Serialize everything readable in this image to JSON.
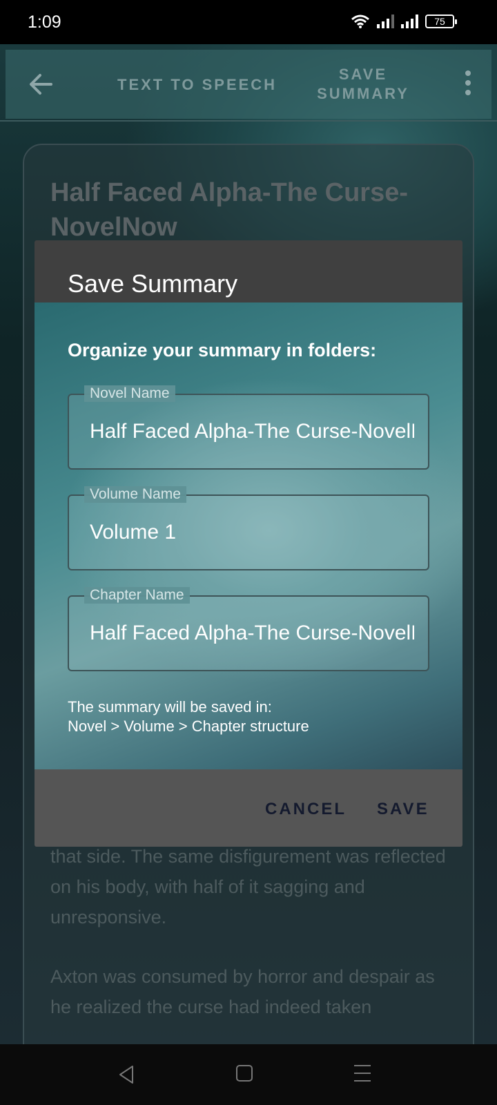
{
  "status_bar": {
    "time": "1:09",
    "battery": "75",
    "icons": [
      "wifi-icon",
      "signal-icon",
      "signal-icon",
      "battery-icon"
    ]
  },
  "toolbar": {
    "back_icon": "arrow-back-icon",
    "text_to_speech": "TEXT TO SPEECH",
    "save_summary": "SAVE SUMMARY",
    "more_icon": "more-vert-icon"
  },
  "content": {
    "title": "Half Faced Alpha-The Curse-NovelNow",
    "paragraph_1": "that side. The same disfigurement was reflected on his body, with half of it sagging and unresponsive.",
    "paragraph_2": "Axton was consumed by horror and despair as he realized the curse had indeed taken"
  },
  "dialog": {
    "title": "Save Summary",
    "heading": "Organize your summary in folders:",
    "fields": [
      {
        "label": "Novel Name",
        "value": "Half Faced Alpha-The Curse-NovelNow"
      },
      {
        "label": "Volume Name",
        "value": "Volume 1"
      },
      {
        "label": "Chapter Name",
        "value": "Half Faced Alpha-The Curse-NovelNow"
      }
    ],
    "note_line1": "The summary will be saved in:",
    "note_line2": "Novel > Volume > Chapter structure",
    "cancel_label": "CANCEL",
    "save_label": "SAVE"
  },
  "nav_bar": {
    "icons": [
      "nav-back-icon",
      "nav-home-icon",
      "nav-menu-icon"
    ]
  }
}
